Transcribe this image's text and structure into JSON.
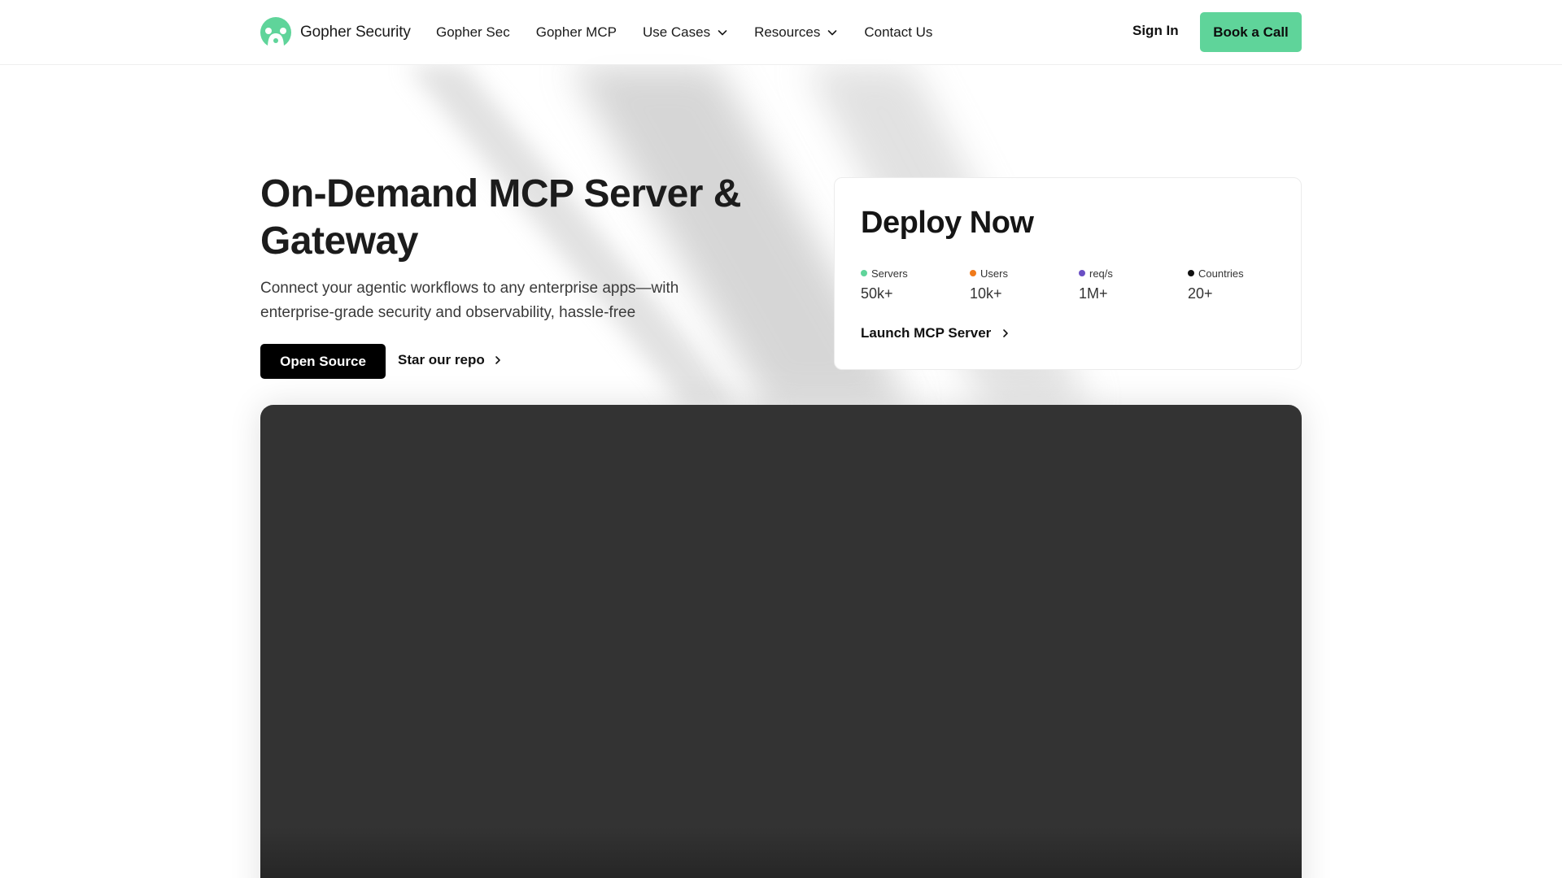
{
  "brand": {
    "name": "Gopher Security"
  },
  "nav": {
    "items": [
      {
        "label": "Gopher Sec",
        "has_dropdown": false
      },
      {
        "label": "Gopher MCP",
        "has_dropdown": false
      },
      {
        "label": "Use Cases",
        "has_dropdown": true
      },
      {
        "label": "Resources",
        "has_dropdown": true
      },
      {
        "label": "Contact Us",
        "has_dropdown": false
      }
    ],
    "sign_in": "Sign In",
    "cta": "Book a Call"
  },
  "hero": {
    "title": "On-Demand MCP Server & Gateway",
    "subtitle": "Connect your agentic workflows to any enterprise apps—with enterprise-grade security and observability, hassle-free",
    "primary_button": "Open Source",
    "secondary_link": "Star our repo"
  },
  "deploy_card": {
    "title": "Deploy Now",
    "stats": [
      {
        "label": "Servers",
        "value": "50k+",
        "color": "#5fd49a"
      },
      {
        "label": "Users",
        "value": "10k+",
        "color": "#f07a1a"
      },
      {
        "label": "req/s",
        "value": "1M+",
        "color": "#6a4fc4"
      },
      {
        "label": "Countries",
        "value": "20+",
        "color": "#111111"
      }
    ],
    "link": "Launch MCP Server"
  },
  "colors": {
    "accent": "#5fd49a",
    "panel": "#333333"
  }
}
